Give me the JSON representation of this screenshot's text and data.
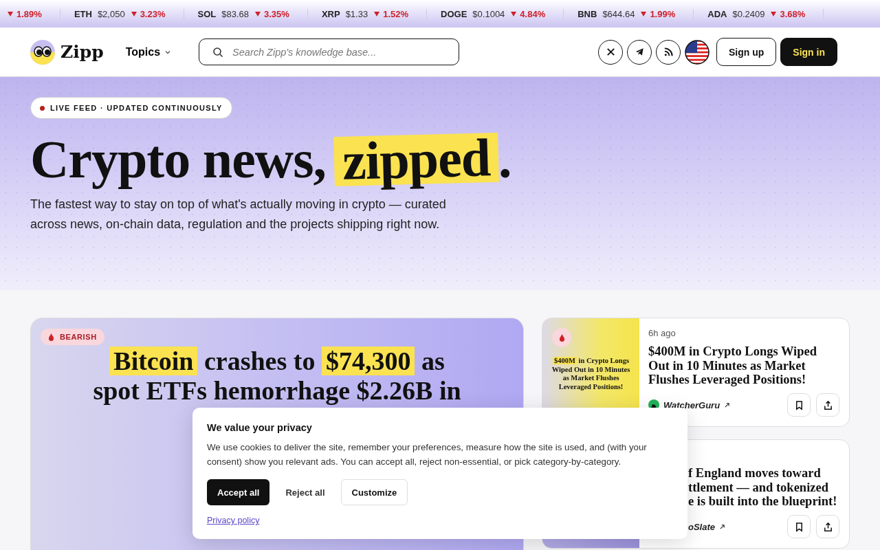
{
  "ticker": [
    {
      "change": "1.89%",
      "falling": true
    },
    {
      "symbol": "ETH",
      "price": "$2,050",
      "change": "3.23%",
      "falling": true
    },
    {
      "symbol": "SOL",
      "price": "$83.68",
      "change": "3.35%",
      "falling": true
    },
    {
      "symbol": "XRP",
      "price": "$1.33",
      "change": "1.52%",
      "falling": true
    },
    {
      "symbol": "DOGE",
      "price": "$0.1004",
      "change": "4.84%",
      "falling": true
    },
    {
      "symbol": "BNB",
      "price": "$644.64",
      "change": "1.99%",
      "falling": true
    },
    {
      "symbol": "ADA",
      "price": "$0.2409",
      "change": "3.68%",
      "falling": true
    }
  ],
  "header": {
    "logo": "Zipp",
    "menu": "Topics",
    "search": {
      "placeholder": "Search Zipp's knowledge base..."
    },
    "social": [
      {
        "kind": "x"
      },
      {
        "kind": "telegram"
      },
      {
        "kind": "rss"
      }
    ],
    "buttons": [
      {
        "label": "Sign up",
        "kind": "outline"
      },
      {
        "label": "Sign in",
        "kind": "primary"
      }
    ]
  },
  "hero": {
    "badge": "LIVE FEED · UPDATED CONTINUOUSLY",
    "title": "Crypto news, ",
    "title_highlight": "zipped",
    "title_end": ".",
    "subtitle": "The fastest way to stay on top of what's actually moving in crypto — curated across news, on-chain data, regulation and the projects shipping right now."
  },
  "featured": {
    "sentiment": "BEARISH",
    "headline": [
      {
        "text": "Bitcoin",
        "highlight": true
      },
      {
        "text": " crashes to ",
        "highlight": false
      },
      {
        "text": "$74,300",
        "highlight": true
      },
      {
        "text": " as spot ETFs hemorrhage $2.26B in",
        "highlight": false
      }
    ]
  },
  "stories": [
    {
      "thumbnail": {
        "highlight": "$400M",
        "rest": " in Crypto Longs Wiped Out in 10 Minutes as Market Flushes Leveraged Positions!"
      },
      "time": "6h ago",
      "title_lines": [
        "$400M in Crypto Longs Wiped",
        "Out in 10 Minutes as Market",
        "Flushes Leveraged Positions!"
      ],
      "source": "WatcherGuru"
    },
    {
      "title_lines": [
        "f England moves toward",
        "ttlement — and tokenized",
        "e is built into the blueprint!"
      ],
      "source": "oSlate"
    }
  ],
  "cookie_banner": {
    "title": "We value your privacy",
    "text": "We use cookies to deliver the site, remember your preferences, measure how the site is used, and (with your consent) show you relevant ads. You can accept all, reject non-essential, or pick category-by-category.",
    "buttons": [
      {
        "label": "Accept all",
        "kind": "primary"
      },
      {
        "label": "Reject all",
        "kind": "plain"
      },
      {
        "label": "Customize",
        "kind": "outline"
      }
    ],
    "link": "Privacy policy"
  }
}
